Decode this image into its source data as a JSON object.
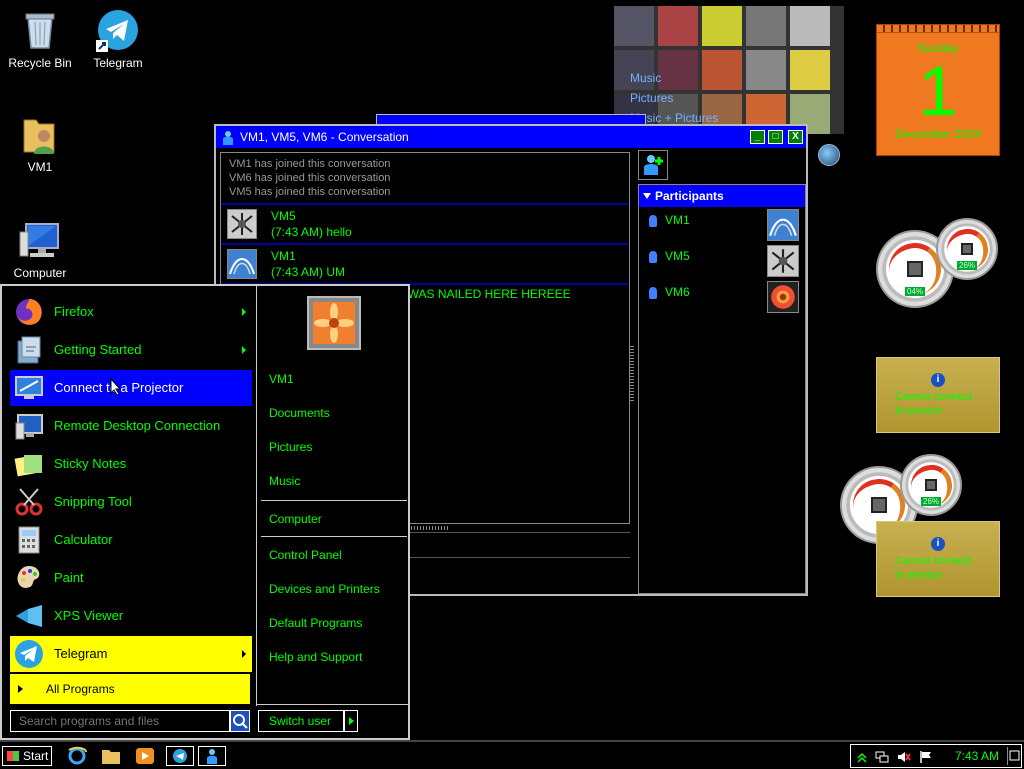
{
  "desktop": {
    "icons": [
      {
        "label": "Recycle Bin",
        "icon": "recycle-bin-icon"
      },
      {
        "label": "Telegram",
        "icon": "telegram-icon"
      },
      {
        "label": "VM1",
        "icon": "user-folder-icon"
      },
      {
        "label": "Computer",
        "icon": "computer-icon"
      }
    ]
  },
  "media_gadget": {
    "menu": [
      "Music",
      "Pictures",
      "Music + Pictures"
    ]
  },
  "calendar": {
    "weekday": "Sunday",
    "day": "1",
    "month_year": "December 2024"
  },
  "cpu_meter": [
    {
      "cpu": "04%",
      "mem": "26%"
    },
    {
      "cpu": "",
      "mem": "26%"
    }
  ],
  "weather": [
    {
      "message_line1": "Cannot connect",
      "message_line2": "to service"
    },
    {
      "message_line1": "Cannot connect",
      "message_line2": "to service"
    }
  ],
  "conversation": {
    "title": "VM1, VM5, VM6 - Conversation",
    "system_messages": [
      "VM1 has joined this conversation",
      "VM6 has joined this conversation",
      "VM5 has joined this conversation"
    ],
    "messages": [
      {
        "sender": "VM5",
        "text": "(7:43 AM) hello"
      },
      {
        "sender": "VM1",
        "text": "(7:43 AM) UM"
      }
    ],
    "partial_message": "I WAS NAILED HERE HEREEE",
    "participants_header": "Participants",
    "participants": [
      "VM1",
      "VM5",
      "VM6"
    ],
    "buttons": {
      "minimize": "_",
      "maximize": "□",
      "close": "X"
    }
  },
  "start_menu": {
    "programs": [
      {
        "label": "Firefox",
        "submenu": true
      },
      {
        "label": "Getting Started",
        "submenu": true
      },
      {
        "label": "Connect to a Projector",
        "submenu": false
      },
      {
        "label": "Remote Desktop Connection",
        "submenu": false
      },
      {
        "label": "Sticky Notes",
        "submenu": false
      },
      {
        "label": "Snipping Tool",
        "submenu": false
      },
      {
        "label": "Calculator",
        "submenu": false
      },
      {
        "label": "Paint",
        "submenu": false
      },
      {
        "label": "XPS Viewer",
        "submenu": false
      },
      {
        "label": "Telegram",
        "submenu": true
      }
    ],
    "all_programs": "All Programs",
    "search_placeholder": "Search programs and files",
    "right_items": [
      "VM1",
      "Documents",
      "Pictures",
      "Music",
      "Computer",
      "Control Panel",
      "Devices and Printers",
      "Default Programs",
      "Help and Support"
    ],
    "switch_user": "Switch user"
  },
  "taskbar": {
    "start_label": "Start",
    "clock": "7:43 AM"
  },
  "colors": {
    "accent_blue": "#0000ff",
    "text_green": "#00ff00",
    "highlight_yellow": "#ffff00"
  }
}
